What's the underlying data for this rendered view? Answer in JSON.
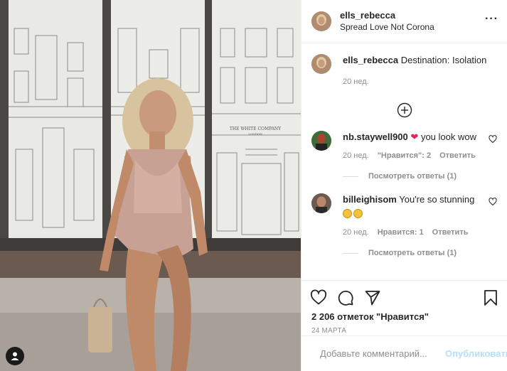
{
  "post": {
    "author": "ells_rebecca",
    "location": "Spread Love Not Corona",
    "more_icon": "ellipsis-icon"
  },
  "caption": {
    "username": "ells_rebecca",
    "text": "Destination: Isolation",
    "time": "20 нед."
  },
  "comments": [
    {
      "username": "nb.staywell900",
      "text": "you look wow",
      "time": "20 нед.",
      "likes": "\"Нравится\": 2",
      "reply": "Ответить",
      "view_replies": "Посмотреть ответы (1)"
    },
    {
      "username": "billeighisom",
      "text": "You're so stunning",
      "time": "20 нед.",
      "likes": "Нравится: 1",
      "reply": "Ответить",
      "view_replies": "Посмотреть ответы (1)"
    }
  ],
  "actions": {
    "likes": "2 206 отметок \"Нравится\"",
    "date": "24 МАРТА"
  },
  "add_comment": {
    "placeholder": "Добавьте комментарий...",
    "publish": "Опубликовать"
  },
  "photo": {
    "store_sign": "THE WHITE COMPANY",
    "store_sign_sub": "LONDON"
  },
  "colors": {
    "accent": "#0095f6",
    "publish_disabled": "#b2dffc",
    "heart_red": "#e0245e",
    "meta_gray": "#8e8e8e"
  }
}
